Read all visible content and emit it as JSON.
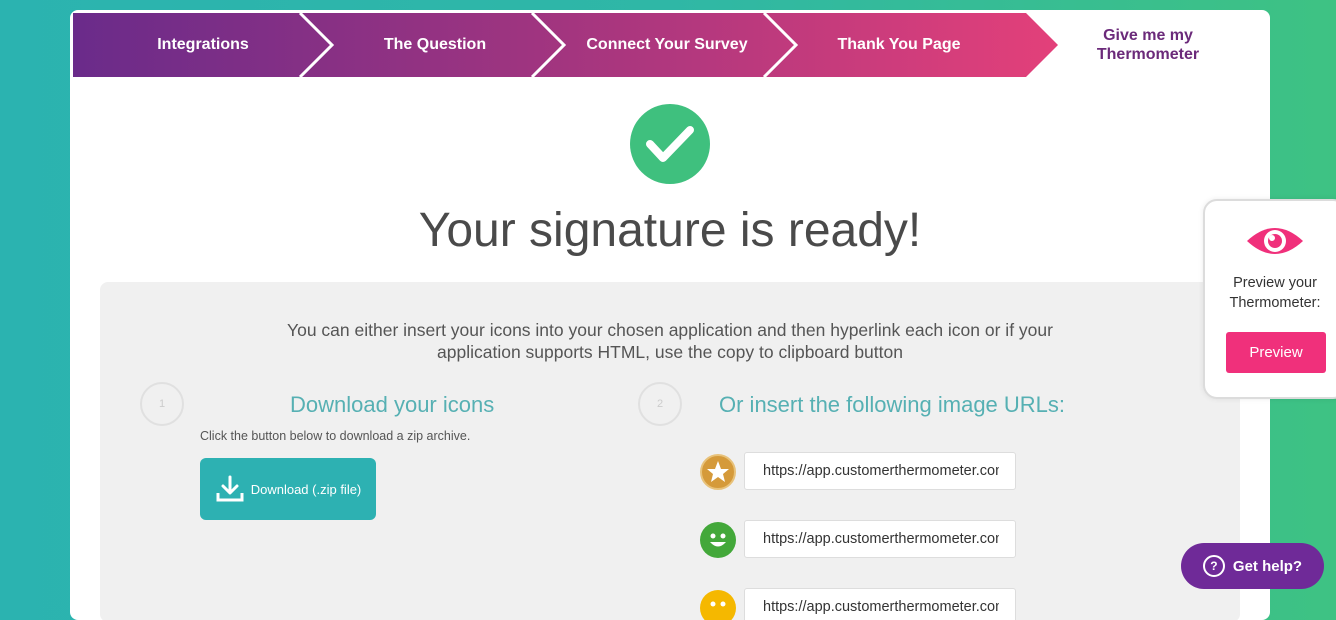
{
  "steps": [
    {
      "label": "Integrations"
    },
    {
      "label": "The Question"
    },
    {
      "label": "Connect Your Survey"
    },
    {
      "label": "Thank You Page"
    },
    {
      "label": "Give me my Thermometer"
    }
  ],
  "heading": "Your signature is ready!",
  "intro": "You can either insert your icons into your chosen application and then hyperlink each icon or if your application supports HTML, use the copy to clipboard button",
  "section1": {
    "number": "1",
    "title": "Download your icons",
    "subtitle": "Click the button below to download a zip archive.",
    "button": "Download (.zip file)"
  },
  "section2": {
    "number": "2",
    "title": "Or insert the following image URLs:"
  },
  "urls": [
    {
      "value": "https://app.customerthermometer.com",
      "icon": "gold-star-icon",
      "color": "#d59a3a"
    },
    {
      "value": "https://app.customerthermometer.com",
      "icon": "green-smile-icon",
      "color": "#43a83a"
    },
    {
      "value": "https://app.customerthermometer.com",
      "icon": "yellow-face-icon",
      "color": "#f5b800"
    }
  ],
  "preview": {
    "text": "Preview your Thermometer:",
    "button": "Preview"
  },
  "help": {
    "label": "Get help?"
  },
  "colors": {
    "accent": "#2db1b2",
    "pink": "#f0307b",
    "purple": "#6f2a98",
    "green": "#3fc07e"
  }
}
